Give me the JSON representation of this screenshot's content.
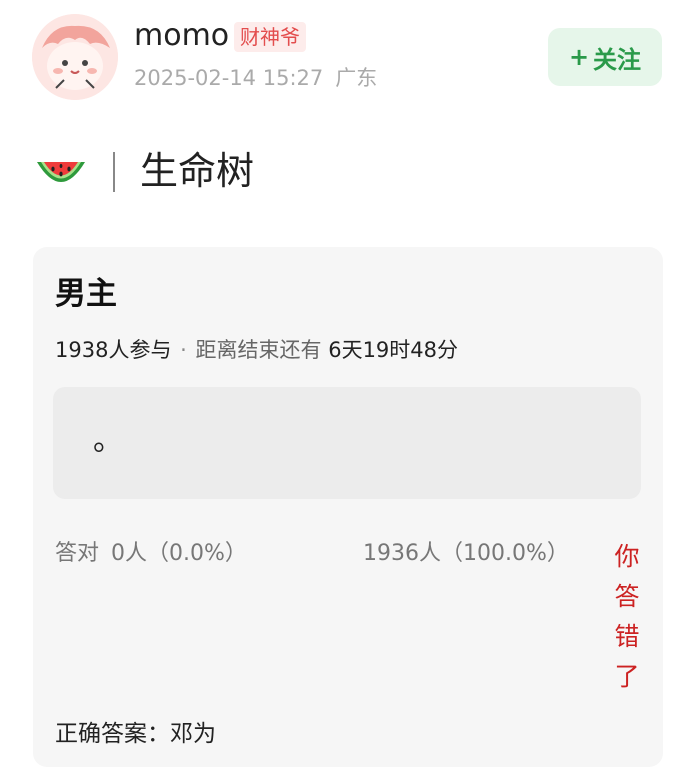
{
  "user": {
    "name": "momo",
    "badge": "财神爷",
    "timestamp": "2025-02-14 15:27",
    "location": "广东",
    "avatar_icon": "pink-cartoon-avatar"
  },
  "follow_button": {
    "plus": "+",
    "label": "关注"
  },
  "topic": {
    "icon": "watermelon-icon",
    "title": "生命树"
  },
  "quiz": {
    "title": "男主",
    "participants": "1938人参与",
    "separator": "·",
    "countdown_label": "距离结束还有",
    "countdown_value": "6天19时48分",
    "answer_text": "。",
    "correct_label": "答对",
    "correct_stat": "0人（0.0%）",
    "wrong_stat": "1936人（100.0%）",
    "wrong_tag": "你答错了",
    "correct_answer": "正确答案：邓为"
  },
  "colors": {
    "follow_bg": "#e6f6ea",
    "follow_text": "#2a9a4a",
    "badge_text": "#e34d4d",
    "wrong_text": "#cc2222"
  }
}
